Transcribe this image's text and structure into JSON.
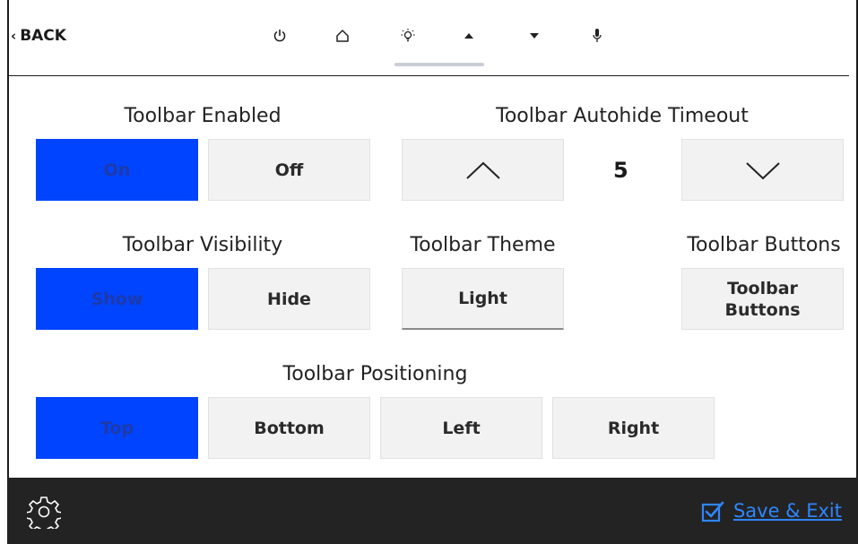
{
  "header": {
    "back_label": "BACK",
    "icons": [
      "power-icon",
      "home-icon",
      "lightbulb-icon",
      "triangle-up-icon",
      "triangle-down-icon",
      "microphone-icon"
    ]
  },
  "toolbar_enabled": {
    "title": "Toolbar Enabled",
    "on": "On",
    "off": "Off",
    "selected": "On"
  },
  "autohide": {
    "title": "Toolbar Autohide Timeout",
    "value": "5"
  },
  "visibility": {
    "title": "Toolbar Visibility",
    "show": "Show",
    "hide": "Hide",
    "selected": "Show"
  },
  "theme": {
    "title": "Toolbar Theme",
    "value": "Light"
  },
  "buttons": {
    "title": "Toolbar Buttons",
    "button_line1": "Toolbar",
    "button_line2": "Buttons"
  },
  "positioning": {
    "title": "Toolbar Positioning",
    "top": "Top",
    "bottom": "Bottom",
    "left": "Left",
    "right": "Right",
    "selected": "Top"
  },
  "footer": {
    "save_label": "Save & Exit"
  },
  "colors": {
    "accent": "#0044ff",
    "footer_bg": "#232323",
    "link": "#2e86ff",
    "button_bg": "#f2f2f2"
  }
}
